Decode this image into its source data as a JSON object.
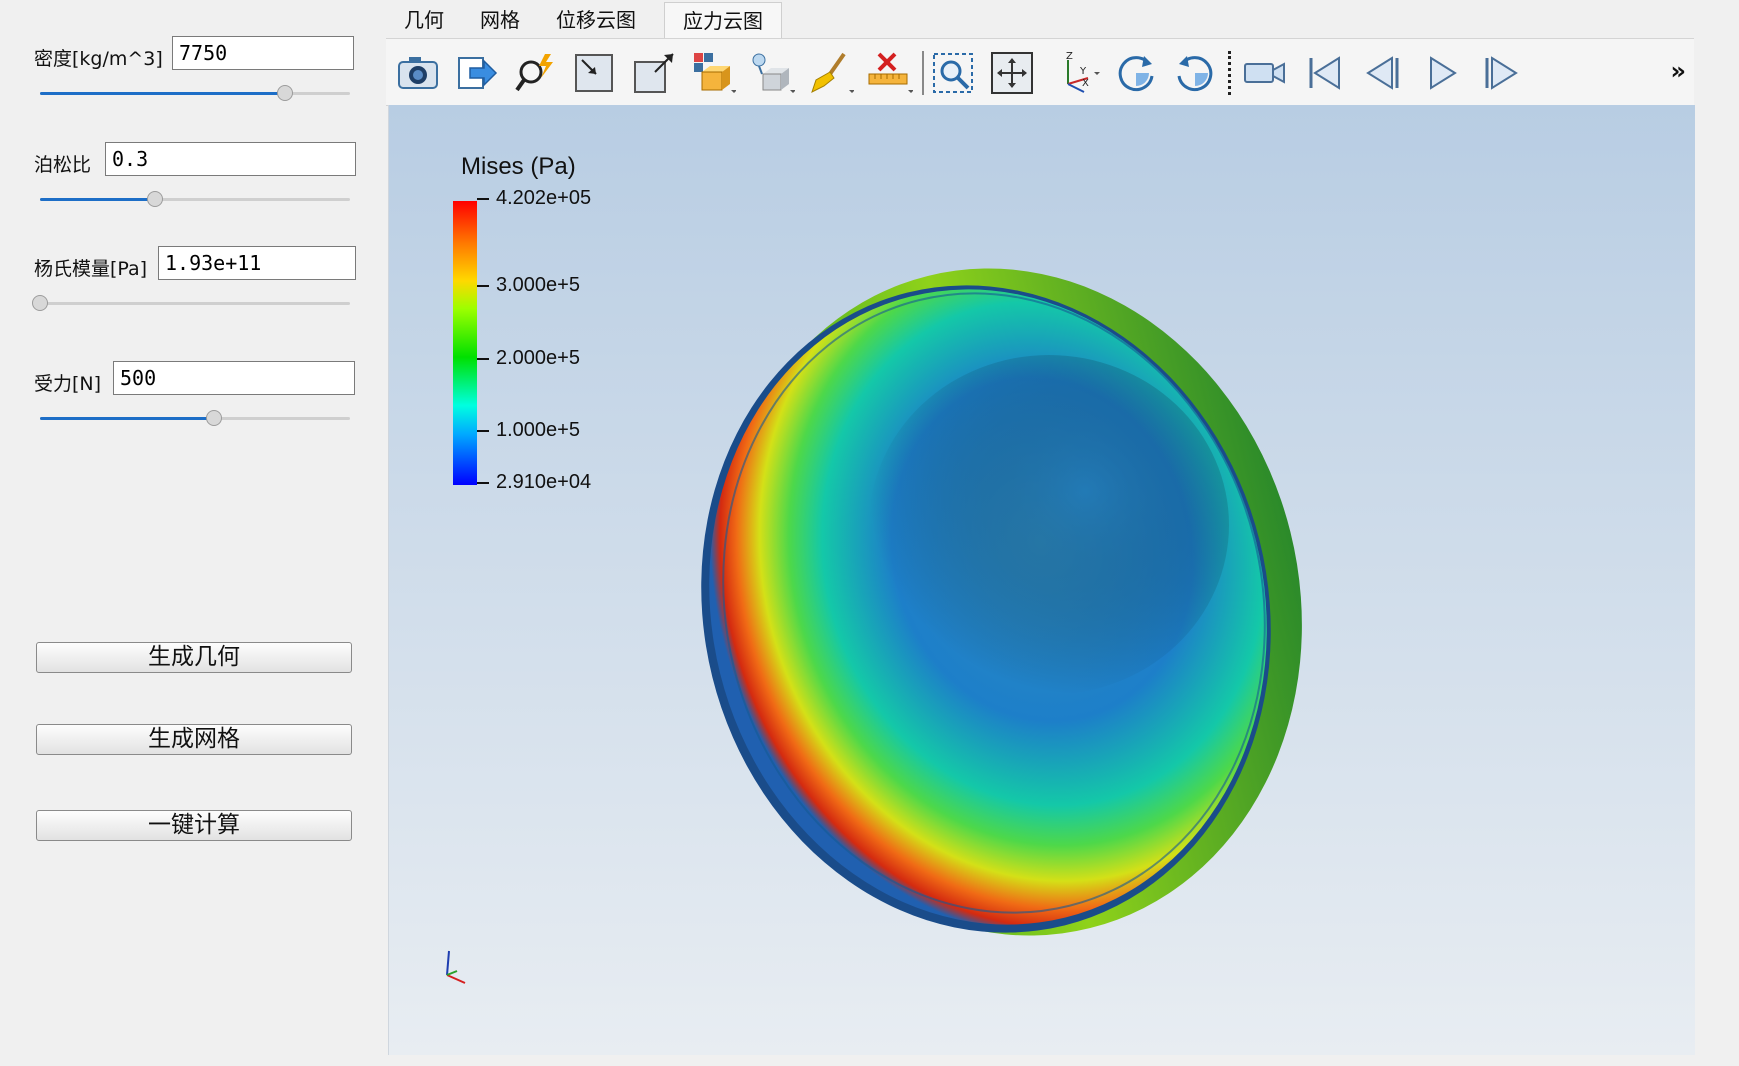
{
  "params": {
    "density": {
      "label": "密度[kg/m^3]",
      "value": "7750",
      "slider": 0.79
    },
    "poisson": {
      "label": "泊松比",
      "value": "0.3",
      "slider": 0.37
    },
    "youngs": {
      "label": "杨氏模量[Pa]",
      "value": "1.93e+11",
      "slider": 0.0
    },
    "force": {
      "label": "受力[N]",
      "value": "500",
      "slider": 0.56
    }
  },
  "buttons": {
    "gen_geometry": "生成几何",
    "gen_mesh": "生成网格",
    "compute": "一键计算"
  },
  "tabs": [
    {
      "label": "几何",
      "active": false
    },
    {
      "label": "网格",
      "active": false
    },
    {
      "label": "位移云图",
      "active": false
    },
    {
      "label": "应力云图",
      "active": true
    }
  ],
  "toolbar": {
    "icons": [
      "camera-icon",
      "export-icon",
      "probe-icon",
      "reset-view-icon",
      "zoom-to-box-icon",
      "add-box-icon",
      "add-probe-box-icon",
      "clear-icon",
      "ruler-icon",
      "rubberband-zoom-icon",
      "fit-view-icon",
      "axes-orientation-icon",
      "rotate-cw-icon",
      "rotate-ccw-icon",
      "record-icon",
      "first-frame-icon",
      "prev-frame-icon",
      "play-icon",
      "next-frame-icon"
    ],
    "overflow": "»"
  },
  "legend": {
    "title": "Mises (Pa)",
    "ticks": [
      "4.202e+05",
      "3.000e+5",
      "2.000e+5",
      "1.000e+5",
      "2.910e+04"
    ],
    "tick_values": [
      420200,
      300000,
      200000,
      100000,
      29100
    ],
    "min": 29100,
    "max": 420200
  },
  "colors": {
    "accent": "#1d6ec7"
  }
}
